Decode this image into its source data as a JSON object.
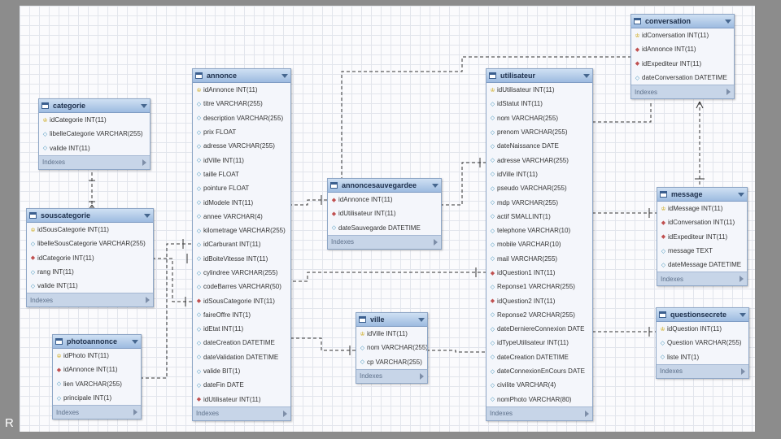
{
  "corner_letter": "R",
  "footer_label": "Indexes",
  "colors": {
    "header": "#9dbbe0",
    "footer": "#c7d5e8",
    "line": "#333333",
    "canvas": "#fbfbfd"
  },
  "tables": {
    "categorie": {
      "name": "categorie",
      "columns": [
        {
          "text": "idCategorie INT(11)",
          "icon": "key-icon"
        },
        {
          "text": "libelleCategorie VARCHAR(255)",
          "icon": "field-icon"
        },
        {
          "text": "valide INT(11)",
          "icon": "field-icon"
        }
      ]
    },
    "souscategorie": {
      "name": "souscategorie",
      "columns": [
        {
          "text": "idSousCategorie INT(11)",
          "icon": "key-icon"
        },
        {
          "text": "libelleSousCategorie VARCHAR(255)",
          "icon": "field-icon"
        },
        {
          "text": "idCategorie INT(11)",
          "icon": "fk-icon"
        },
        {
          "text": "rang INT(11)",
          "icon": "field-icon"
        },
        {
          "text": "valide INT(11)",
          "icon": "field-icon"
        }
      ]
    },
    "photoannonce": {
      "name": "photoannonce",
      "columns": [
        {
          "text": "idPhoto INT(11)",
          "icon": "key-icon"
        },
        {
          "text": "idAnnonce INT(11)",
          "icon": "fk-icon"
        },
        {
          "text": "lien VARCHAR(255)",
          "icon": "field-icon"
        },
        {
          "text": "principale INT(1)",
          "icon": "field-icon"
        }
      ]
    },
    "annonce": {
      "name": "annonce",
      "columns": [
        {
          "text": "idAnnonce INT(11)",
          "icon": "key-icon"
        },
        {
          "text": "titre VARCHAR(255)",
          "icon": "field-icon"
        },
        {
          "text": "description VARCHAR(255)",
          "icon": "field-icon"
        },
        {
          "text": "prix FLOAT",
          "icon": "field-icon"
        },
        {
          "text": "adresse VARCHAR(255)",
          "icon": "field-icon"
        },
        {
          "text": "idVille INT(11)",
          "icon": "field-icon"
        },
        {
          "text": "taille FLOAT",
          "icon": "field-icon"
        },
        {
          "text": "pointure FLOAT",
          "icon": "field-icon"
        },
        {
          "text": "idModele INT(11)",
          "icon": "field-icon"
        },
        {
          "text": "annee VARCHAR(4)",
          "icon": "field-icon"
        },
        {
          "text": "kilometrage VARCHAR(255)",
          "icon": "field-icon"
        },
        {
          "text": "idCarburant INT(11)",
          "icon": "field-icon"
        },
        {
          "text": "idBoiteVitesse INT(11)",
          "icon": "field-icon"
        },
        {
          "text": "cylindree VARCHAR(255)",
          "icon": "field-icon"
        },
        {
          "text": "codeBarres VARCHAR(50)",
          "icon": "field-icon"
        },
        {
          "text": "idSousCategorie INT(11)",
          "icon": "fk-icon"
        },
        {
          "text": "faireOffre INT(1)",
          "icon": "field-icon"
        },
        {
          "text": "idEtat INT(11)",
          "icon": "field-icon"
        },
        {
          "text": "dateCreation DATETIME",
          "icon": "field-icon"
        },
        {
          "text": "dateValidation DATETIME",
          "icon": "field-icon"
        },
        {
          "text": "valide BIT(1)",
          "icon": "field-icon"
        },
        {
          "text": "dateFin DATE",
          "icon": "field-icon"
        },
        {
          "text": "idUtilisateur INT(11)",
          "icon": "fk-icon"
        }
      ]
    },
    "annoncesauvegardee": {
      "name": "annoncesauvegardee",
      "columns": [
        {
          "text": "idAnnonce INT(11)",
          "icon": "fk-icon"
        },
        {
          "text": "idUtilisateur INT(11)",
          "icon": "fk-icon"
        },
        {
          "text": "dateSauvegarde DATETIME",
          "icon": "field-icon"
        }
      ]
    },
    "ville": {
      "name": "ville",
      "columns": [
        {
          "text": "idVille INT(11)",
          "icon": "key-icon"
        },
        {
          "text": "nom VARCHAR(255)",
          "icon": "field-icon"
        },
        {
          "text": "cp VARCHAR(255)",
          "icon": "field-icon"
        }
      ]
    },
    "utilisateur": {
      "name": "utilisateur",
      "columns": [
        {
          "text": "idUtilisateur INT(11)",
          "icon": "key-icon"
        },
        {
          "text": "idStatut INT(11)",
          "icon": "field-icon"
        },
        {
          "text": "nom VARCHAR(255)",
          "icon": "field-icon"
        },
        {
          "text": "prenom VARCHAR(255)",
          "icon": "field-icon"
        },
        {
          "text": "dateNaissance DATE",
          "icon": "field-icon"
        },
        {
          "text": "adresse VARCHAR(255)",
          "icon": "field-icon"
        },
        {
          "text": "idVille INT(11)",
          "icon": "field-icon"
        },
        {
          "text": "pseudo VARCHAR(255)",
          "icon": "field-icon"
        },
        {
          "text": "mdp VARCHAR(255)",
          "icon": "field-icon"
        },
        {
          "text": "actif SMALLINT(1)",
          "icon": "field-icon"
        },
        {
          "text": "telephone VARCHAR(10)",
          "icon": "field-icon"
        },
        {
          "text": "mobile VARCHAR(10)",
          "icon": "field-icon"
        },
        {
          "text": "mail VARCHAR(255)",
          "icon": "field-icon"
        },
        {
          "text": "idQuestion1 INT(11)",
          "icon": "fk-icon"
        },
        {
          "text": "Reponse1 VARCHAR(255)",
          "icon": "field-icon"
        },
        {
          "text": "idQuestion2 INT(11)",
          "icon": "fk-icon"
        },
        {
          "text": "Reponse2 VARCHAR(255)",
          "icon": "field-icon"
        },
        {
          "text": "dateDerniereConnexion DATE",
          "icon": "field-icon"
        },
        {
          "text": "idTypeUtilisateur INT(11)",
          "icon": "field-icon"
        },
        {
          "text": "dateCreation DATETIME",
          "icon": "field-icon"
        },
        {
          "text": "dateConnexionEnCours DATE",
          "icon": "field-icon"
        },
        {
          "text": "civilite VARCHAR(4)",
          "icon": "field-icon"
        },
        {
          "text": "nomPhoto VARCHAR(80)",
          "icon": "field-icon"
        }
      ]
    },
    "conversation": {
      "name": "conversation",
      "columns": [
        {
          "text": "idConversation INT(11)",
          "icon": "key-icon"
        },
        {
          "text": "idAnnonce INT(11)",
          "icon": "fk-icon"
        },
        {
          "text": "idExpediteur INT(11)",
          "icon": "fk-icon"
        },
        {
          "text": "dateConversation DATETIME",
          "icon": "field-icon"
        }
      ]
    },
    "message": {
      "name": "message",
      "columns": [
        {
          "text": "idMessage INT(11)",
          "icon": "key-icon"
        },
        {
          "text": "idConversation INT(11)",
          "icon": "fk-icon"
        },
        {
          "text": "idExpediteur INT(11)",
          "icon": "fk-icon"
        },
        {
          "text": "message TEXT",
          "icon": "field-icon"
        },
        {
          "text": "dateMessage DATETIME",
          "icon": "field-icon"
        }
      ]
    },
    "questionsecrete": {
      "name": "questionsecrete",
      "columns": [
        {
          "text": "idQuestion INT(11)",
          "icon": "key-icon"
        },
        {
          "text": "Question VARCHAR(255)",
          "icon": "field-icon"
        },
        {
          "text": "liste INT(1)",
          "icon": "field-icon"
        }
      ]
    }
  }
}
